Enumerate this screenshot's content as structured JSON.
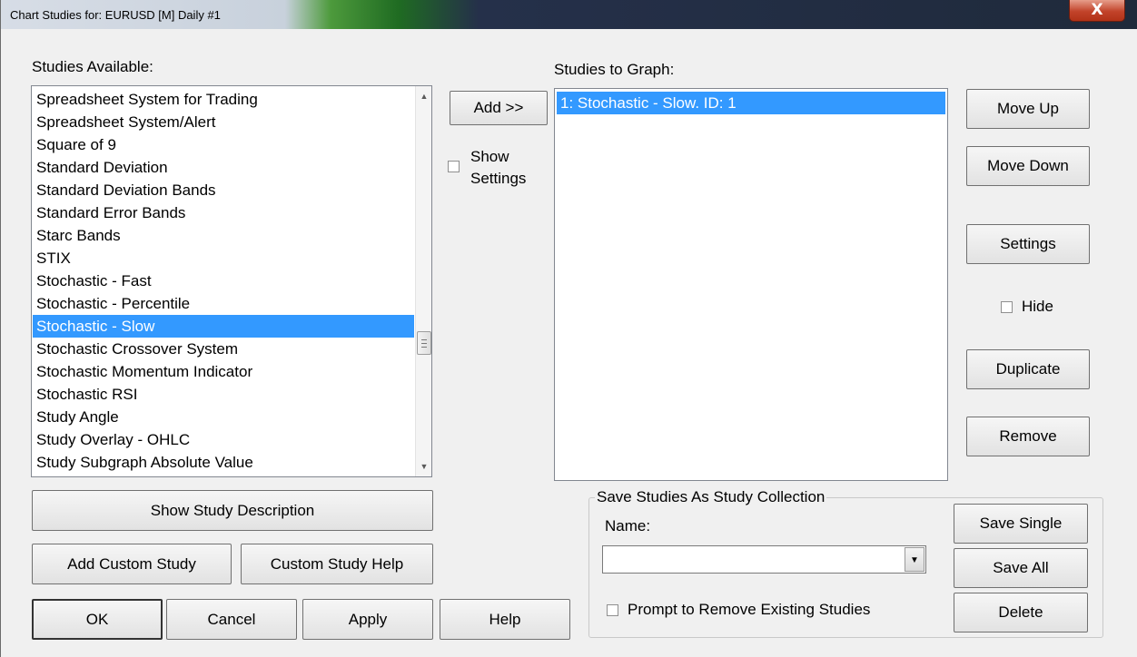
{
  "window": {
    "title": "Chart Studies for: EURUSD [M]  Daily  #1",
    "close_glyph": "X"
  },
  "available": {
    "label": "Studies Available:",
    "items": [
      "Spreadsheet System for Trading",
      "Spreadsheet System/Alert",
      "Square of 9",
      "Standard Deviation",
      "Standard Deviation Bands",
      "Standard Error Bands",
      "Starc Bands",
      "STIX",
      "Stochastic - Fast",
      "Stochastic - Percentile",
      "Stochastic - Slow",
      "Stochastic Crossover System",
      "Stochastic Momentum Indicator",
      "Stochastic RSI",
      "Study Angle",
      "Study Overlay - OHLC",
      "Study Subgraph Absolute Value"
    ],
    "selected": "Stochastic - Slow"
  },
  "middle": {
    "add_label": "Add >>",
    "show_settings_line1": "Show",
    "show_settings_line2": "Settings"
  },
  "graph": {
    "label": "Studies to Graph:",
    "items": [
      "1: Stochastic - Slow. ID: 1"
    ]
  },
  "right_buttons": {
    "move_up": "Move Up",
    "move_down": "Move Down",
    "settings": "Settings",
    "hide": "Hide",
    "duplicate": "Duplicate",
    "remove": "Remove"
  },
  "left_buttons": {
    "show_description": "Show Study Description",
    "add_custom": "Add Custom Study",
    "custom_help": "Custom Study Help"
  },
  "bottom_buttons": {
    "ok": "OK",
    "cancel": "Cancel",
    "apply": "Apply",
    "help": "Help"
  },
  "collection": {
    "legend": "Save Studies As Study Collection",
    "name_label": "Name:",
    "name_value": "",
    "prompt_label": "Prompt to Remove Existing Studies",
    "save_single": "Save Single",
    "save_all": "Save All",
    "delete": "Delete"
  },
  "icons": {
    "scroll_up": "scroll-up-arrow-icon",
    "scroll_down": "scroll-down-arrow-icon",
    "dropdown": "chevron-down-icon",
    "close": "close-icon"
  }
}
